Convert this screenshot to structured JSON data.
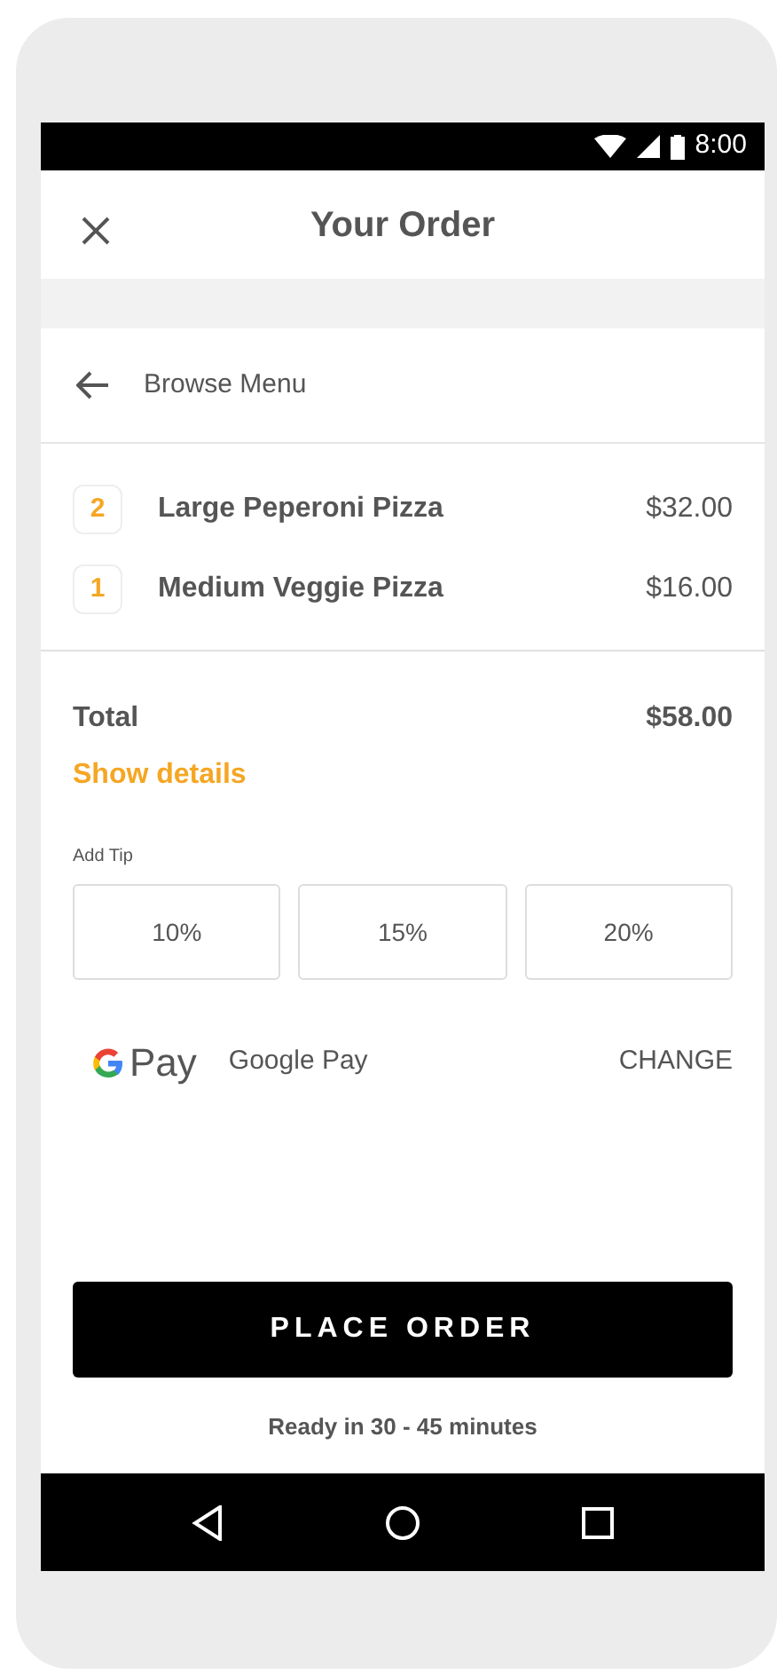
{
  "status_bar": {
    "time": "8:00"
  },
  "header": {
    "title": "Your Order"
  },
  "browse": {
    "label": "Browse Menu"
  },
  "items": [
    {
      "quantity": "2",
      "name": "Large Peperoni Pizza",
      "price": "$32.00"
    },
    {
      "quantity": "1",
      "name": "Medium Veggie Pizza",
      "price": "$16.00"
    }
  ],
  "total": {
    "label": "Total",
    "amount": "$58.00",
    "details_link": "Show details"
  },
  "tip": {
    "label": "Add Tip",
    "options": [
      {
        "label": "10%",
        "selected": false
      },
      {
        "label": "15%",
        "selected": false
      },
      {
        "label": "20%",
        "selected": false
      }
    ]
  },
  "payment": {
    "logo_text": "Pay",
    "method": "Google Pay",
    "action": "CHANGE"
  },
  "place_order": {
    "label": "PLACE ORDER",
    "note": "Ready in 30 - 45 minutes"
  }
}
